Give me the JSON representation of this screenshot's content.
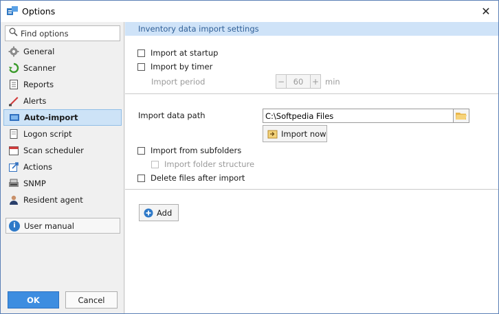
{
  "window": {
    "title": "Options",
    "close_label": "✕"
  },
  "sidebar": {
    "search_placeholder": "Find options",
    "items": [
      {
        "label": "General",
        "icon": "gear-icon"
      },
      {
        "label": "Scanner",
        "icon": "scanner-icon"
      },
      {
        "label": "Reports",
        "icon": "report-icon"
      },
      {
        "label": "Alerts",
        "icon": "alert-icon"
      },
      {
        "label": "Auto-import",
        "icon": "auto-import-icon"
      },
      {
        "label": "Logon script",
        "icon": "script-icon"
      },
      {
        "label": "Scan scheduler",
        "icon": "calendar-icon"
      },
      {
        "label": "Actions",
        "icon": "actions-icon"
      },
      {
        "label": "SNMP",
        "icon": "snmp-icon"
      },
      {
        "label": "Resident agent",
        "icon": "agent-icon"
      }
    ],
    "user_manual": "User manual",
    "ok": "OK",
    "cancel": "Cancel"
  },
  "main": {
    "section_title": "Inventory data import settings",
    "import_at_startup": "Import at startup",
    "import_by_timer": "Import by timer",
    "import_period_label": "Import period",
    "import_period_value": "60",
    "import_period_unit": "min",
    "import_data_path_label": "Import data path",
    "import_data_path_value": "C:\\Softpedia Files",
    "import_now": "Import now",
    "import_from_subfolders": "Import from subfolders",
    "import_folder_structure": "Import folder structure",
    "delete_files_after_import": "Delete files after import",
    "add": "Add"
  },
  "colors": {
    "accent": "#3d8de0",
    "selection": "#cde3f7",
    "section_header": "#cfe3f8"
  }
}
